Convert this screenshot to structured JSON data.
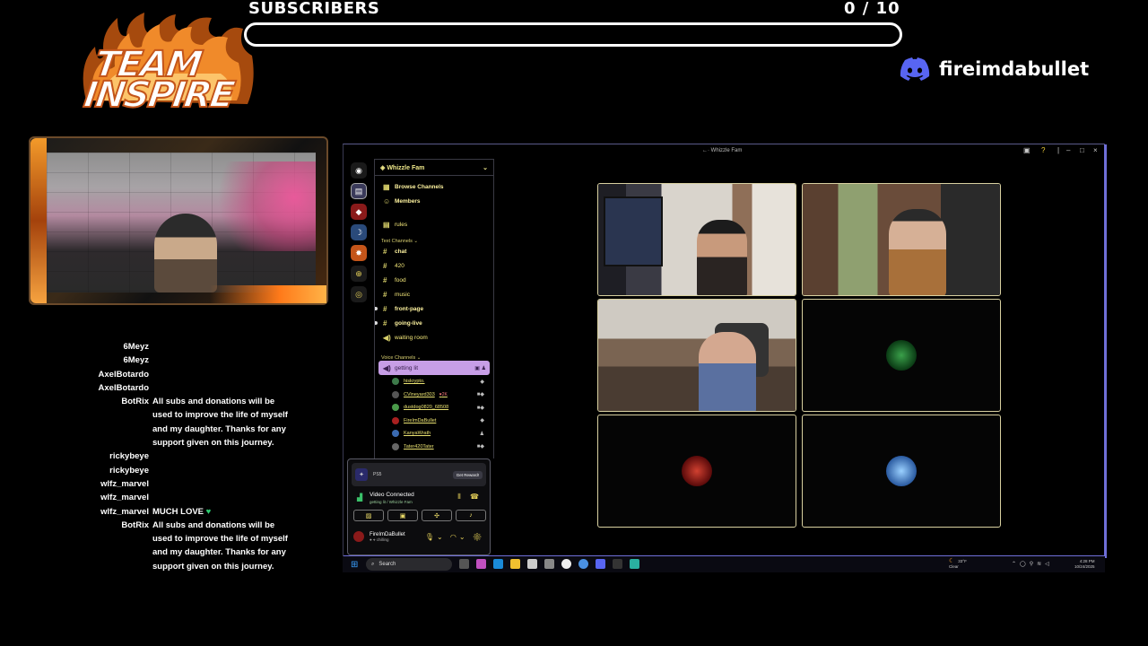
{
  "overlay": {
    "team_logo": {
      "line1": "TEAM",
      "line2": "INSPIRE"
    },
    "subscribers": {
      "label": "SUBSCRIBERS",
      "count_text": "0  / 10",
      "current": 0,
      "goal": 10
    },
    "discord_handle": "fireimdabullet",
    "accent_color": "#c4551a"
  },
  "chat": [
    {
      "user": "6Meyz",
      "message": ""
    },
    {
      "user": "6Meyz",
      "message": ""
    },
    {
      "user": "AxelBotardo",
      "message": ""
    },
    {
      "user": "AxelBotardo",
      "message": ""
    },
    {
      "user": "BotRix",
      "message": "All subs and donations will be used to improve the life of myself and my daughter. Thanks for any support given on this journey."
    },
    {
      "user": "rickybeye",
      "message": ""
    },
    {
      "user": "rickybeye",
      "message": ""
    },
    {
      "user": "wlfz_marvel",
      "message": ""
    },
    {
      "user": "wlfz_marvel",
      "message": ""
    },
    {
      "user": "wlfz_marvel",
      "message": "MUCH LOVE",
      "emote": "heart-icon"
    },
    {
      "user": "BotRix",
      "message": "All subs and donations will be used to improve the life of myself and my daughter. Thanks for any support given on this journey."
    }
  ],
  "discord": {
    "window_title": "Whizzle Fam",
    "server_name": "Whizzle Fam",
    "top_links": [
      "Browse Channels",
      "Members"
    ],
    "rules_channel": "rules",
    "text_category": "Text Channels",
    "text_channels": [
      "chat",
      "420",
      "food",
      "music",
      "front-page",
      "going-live",
      "waiting room"
    ],
    "voice_category": "Voice Channels",
    "active_voice_channel": "getting lit",
    "voice_members": [
      "hiskrypto.",
      "CVineyard303",
      "dustdog0820_68508",
      "FireImDaBullet",
      "KanyaWrath",
      "Tater420Tater"
    ],
    "voice_member_badge": "2K",
    "ps_label": "PS5",
    "reward_button": "Get Reward!",
    "connection_status": "Video Connected",
    "connection_sub": "getting lit / Whizzle Fam",
    "self_name": "FireImDaBullet",
    "self_status": "chilling"
  },
  "taskbar": {
    "search_placeholder": "Search",
    "weather_temp": "33°F",
    "weather_desc": "Clear",
    "time": "4:28 PM",
    "date": "10/24/2025"
  }
}
